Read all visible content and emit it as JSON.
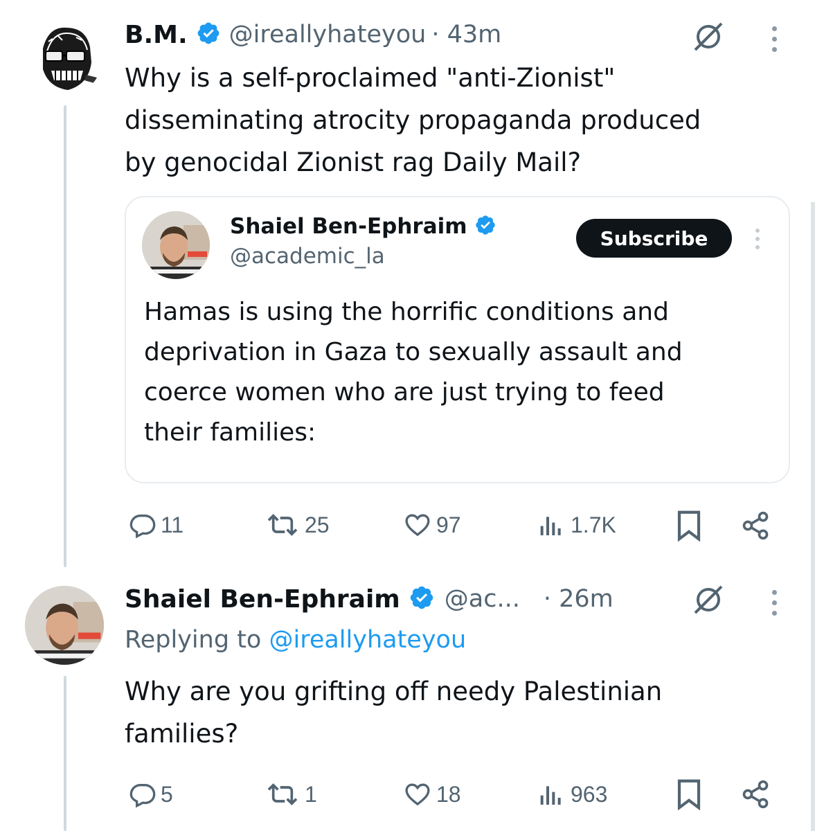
{
  "tweets": [
    {
      "author_name": "B.M.",
      "handle": "@ireallyhateyou",
      "time": "· 43m",
      "text_lines": [
        "Why is a self-proclaimed \"anti-Zionist\"",
        "disseminating atrocity propaganda produced",
        "by genocidal Zionist rag Daily Mail?"
      ],
      "quote": {
        "author_name": "Shaiel Ben-Ephraim",
        "handle": "@academic_la",
        "subscribe_label": "Subscribe",
        "text_lines": [
          "Hamas is using the horrific conditions and",
          "deprivation in Gaza to sexually assault and",
          "coerce women who are just trying to feed",
          "their families:"
        ]
      },
      "stats": {
        "replies": "11",
        "reposts": "25",
        "likes": "97",
        "views": "1.7K"
      }
    },
    {
      "author_name": "Shaiel Ben-Ephraim",
      "handle": "@ac...",
      "time": "· 26m",
      "replying_prefix": "Replying to",
      "replying_handle": "@ireallyhateyou",
      "text_lines": [
        "Why are you grifting off needy Palestinian",
        "families?"
      ],
      "stats": {
        "replies": "5",
        "reposts": "1",
        "likes": "18",
        "views": "963"
      }
    }
  ],
  "colors": {
    "text": "#0f1419",
    "muted": "#536471",
    "link": "#1d9bf0",
    "verified": "#1d9bf0",
    "border": "#e6ecf0"
  },
  "icons": [
    "verified-badge-icon",
    "grok-icon",
    "more-icon",
    "reply-icon",
    "repost-icon",
    "like-icon",
    "views-icon",
    "bookmark-icon",
    "share-icon"
  ]
}
